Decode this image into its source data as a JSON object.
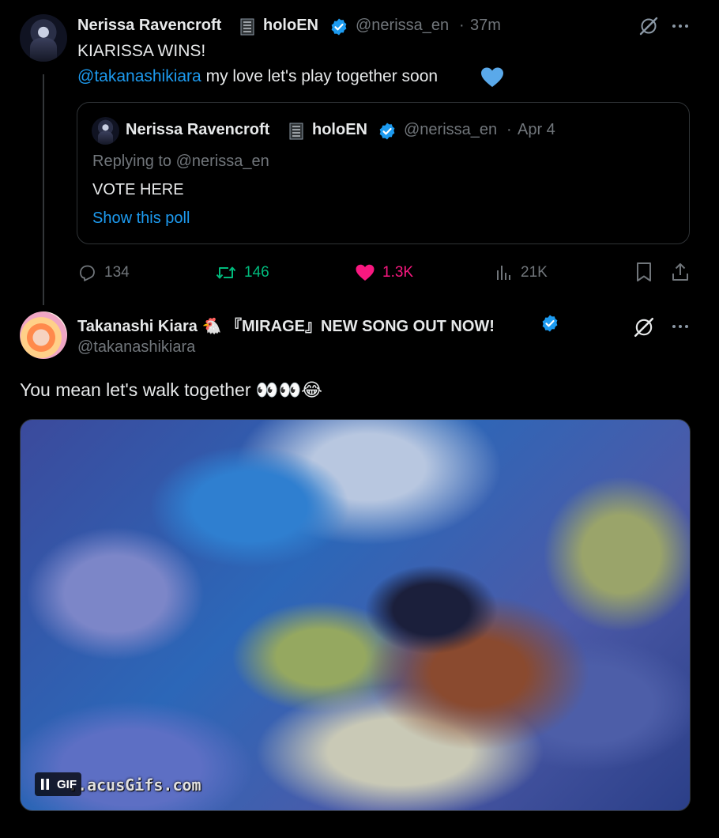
{
  "parent_tweet": {
    "author_name": "Nerissa Ravencroft",
    "author_name_suffix": "holoEN",
    "handle": "@nerissa_en",
    "separator": "·",
    "time": "37m",
    "text_line1": "KIARISSA WINS!",
    "mention": "@takanashikiara",
    "text_line2": "my love let's play together soon",
    "emoji": "💙",
    "quote": {
      "author_name": "Nerissa Ravencroft",
      "author_name_suffix": "holoEN",
      "handle": "@nerissa_en",
      "separator": "·",
      "date": "Apr 4",
      "replying_to": "Replying to @nerissa_en",
      "text": "VOTE HERE",
      "show_poll": "Show this poll"
    },
    "actions": {
      "replies": "134",
      "retweets": "146",
      "likes": "1.3K",
      "views": "21K"
    }
  },
  "reply_tweet": {
    "author_name": "Takanashi Kiara",
    "author_name_emoji": "🐔",
    "author_name_tail": "『MIRAGE』NEW SONG OUT NOW!",
    "handle": "@takanashikiara",
    "text": "You mean let's walk together",
    "text_emoji": "👀👀😂",
    "media": {
      "watermark": "..acusGifs.com",
      "gif_label": "GIF"
    }
  },
  "colors": {
    "background": "#000000",
    "text": "#e7e9ea",
    "muted": "#71767b",
    "accent": "#1d9bf0",
    "retweet": "#00ba7c",
    "like": "#f91880",
    "border": "#2f3336"
  },
  "icons": [
    "verified-icon",
    "grok-icon",
    "more-icon",
    "reply-icon",
    "retweet-icon",
    "like-icon",
    "views-icon",
    "bookmark-icon",
    "share-icon",
    "pause-icon"
  ]
}
